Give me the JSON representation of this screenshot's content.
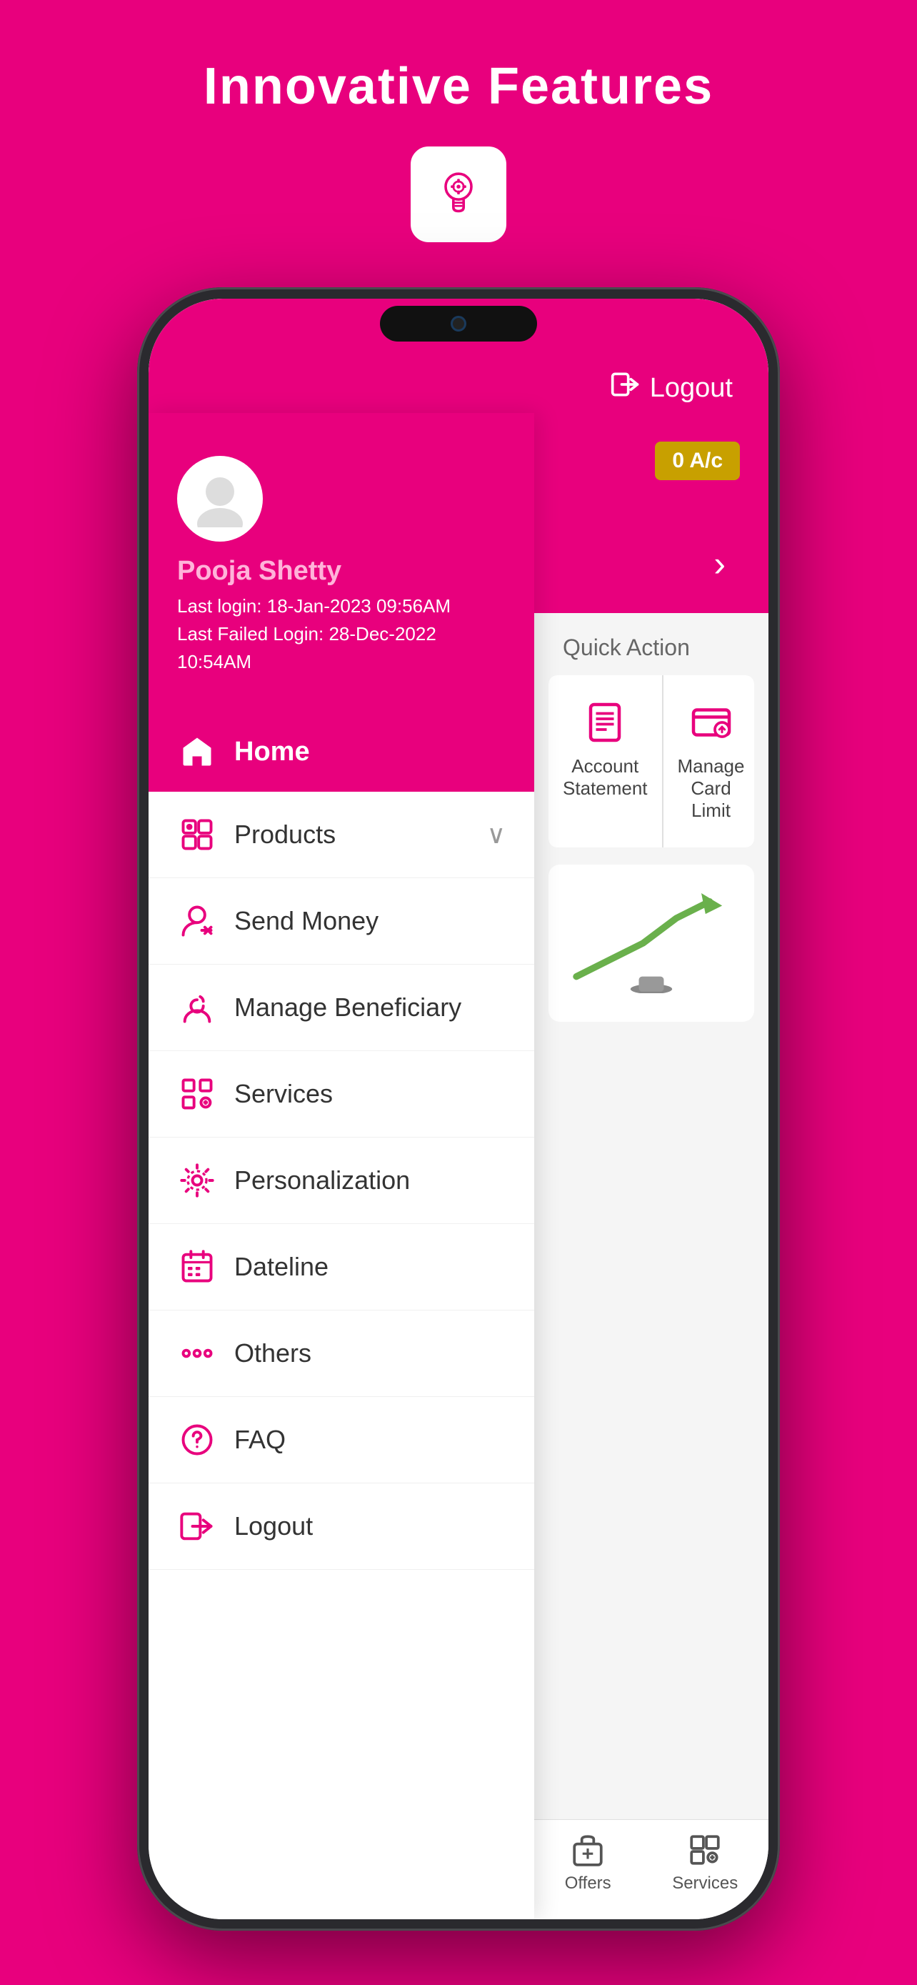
{
  "page": {
    "title": "Innovative Features",
    "background_color": "#E8007D"
  },
  "header": {
    "logout_label": "Logout"
  },
  "user": {
    "name": "Pooja Shetty",
    "last_login": "Last login: 18-Jan-2023 09:56AM",
    "last_failed_login": "Last Failed Login: 28-Dec-2022 10:54AM"
  },
  "account": {
    "badge": "0 A/c"
  },
  "menu": {
    "home_label": "Home",
    "items": [
      {
        "id": "products",
        "label": "Products",
        "has_chevron": true
      },
      {
        "id": "send-money",
        "label": "Send Money",
        "has_chevron": false
      },
      {
        "id": "manage-beneficiary",
        "label": "Manage Beneficiary",
        "has_chevron": false
      },
      {
        "id": "services",
        "label": "Services",
        "has_chevron": false
      },
      {
        "id": "personalization",
        "label": "Personalization",
        "has_chevron": false
      },
      {
        "id": "dateline",
        "label": "Dateline",
        "has_chevron": false
      },
      {
        "id": "others",
        "label": "Others",
        "has_chevron": false
      },
      {
        "id": "faq",
        "label": "FAQ",
        "has_chevron": false
      },
      {
        "id": "logout",
        "label": "Logout",
        "has_chevron": false
      }
    ]
  },
  "quick_actions": {
    "section_label": "Quick Action",
    "items": [
      {
        "id": "account-statement",
        "label": "Account Statement"
      },
      {
        "id": "manage-card-limit",
        "label": "Manage Card Limit"
      }
    ]
  },
  "bottom_nav": {
    "items": [
      {
        "id": "offers",
        "label": "Offers"
      },
      {
        "id": "services",
        "label": "Services"
      }
    ]
  }
}
